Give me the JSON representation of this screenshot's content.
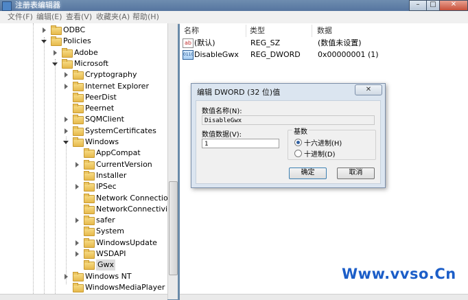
{
  "window": {
    "title": "注册表编辑器",
    "minimize": "–",
    "maximize": "□",
    "close": "✕"
  },
  "menu": [
    "文件(F)",
    "编辑(E)",
    "查看(V)",
    "收藏夹(A)",
    "帮助(H)"
  ],
  "tree": [
    {
      "label": "ODBC",
      "level": 0,
      "state": "closed"
    },
    {
      "label": "Policies",
      "level": 0,
      "state": "open"
    },
    {
      "label": "Adobe",
      "level": 1,
      "state": "closed"
    },
    {
      "label": "Microsoft",
      "level": 1,
      "state": "open"
    },
    {
      "label": "Cryptography",
      "level": 2,
      "state": "closed"
    },
    {
      "label": "Internet Explorer",
      "level": 2,
      "state": "closed"
    },
    {
      "label": "PeerDist",
      "level": 2,
      "state": "none"
    },
    {
      "label": "Peernet",
      "level": 2,
      "state": "none"
    },
    {
      "label": "SQMClient",
      "level": 2,
      "state": "closed"
    },
    {
      "label": "SystemCertificates",
      "level": 2,
      "state": "closed"
    },
    {
      "label": "Windows",
      "level": 2,
      "state": "open"
    },
    {
      "label": "AppCompat",
      "level": 3,
      "state": "none"
    },
    {
      "label": "CurrentVersion",
      "level": 3,
      "state": "closed"
    },
    {
      "label": "Installer",
      "level": 3,
      "state": "none"
    },
    {
      "label": "IPSec",
      "level": 3,
      "state": "closed"
    },
    {
      "label": "Network Connections",
      "level": 3,
      "state": "none"
    },
    {
      "label": "NetworkConnectivitySta",
      "level": 3,
      "state": "none"
    },
    {
      "label": "safer",
      "level": 3,
      "state": "closed"
    },
    {
      "label": "System",
      "level": 3,
      "state": "none"
    },
    {
      "label": "WindowsUpdate",
      "level": 3,
      "state": "closed"
    },
    {
      "label": "WSDAPI",
      "level": 3,
      "state": "closed"
    },
    {
      "label": "Gwx",
      "level": 3,
      "state": "none",
      "selected": true
    },
    {
      "label": "Windows NT",
      "level": 2,
      "state": "closed"
    },
    {
      "label": "WindowsMediaPlayer",
      "level": 2,
      "state": "none"
    }
  ],
  "list": {
    "headers": {
      "name": "名称",
      "type": "类型",
      "data": "数据"
    },
    "rows": [
      {
        "name": "(默认)",
        "type": "REG_SZ",
        "data": "(数值未设置)",
        "icon": "string-value-icon"
      },
      {
        "name": "DisableGwx",
        "type": "REG_DWORD",
        "data": "0x00000001 (1)",
        "icon": "binary-value-icon"
      }
    ]
  },
  "dialog": {
    "title": "编辑 DWORD (32 位)值",
    "close": "✕",
    "name_label": "数值名称(N):",
    "name_value": "DisableGwx",
    "data_label": "数值数据(V):",
    "data_value": "1",
    "base_title": "基数",
    "radio_hex": "十六进制(H)",
    "radio_dec": "十进制(D)",
    "selected_base": "hex",
    "ok": "确定",
    "cancel": "取消"
  },
  "watermark": "Www.vvso.Cn"
}
